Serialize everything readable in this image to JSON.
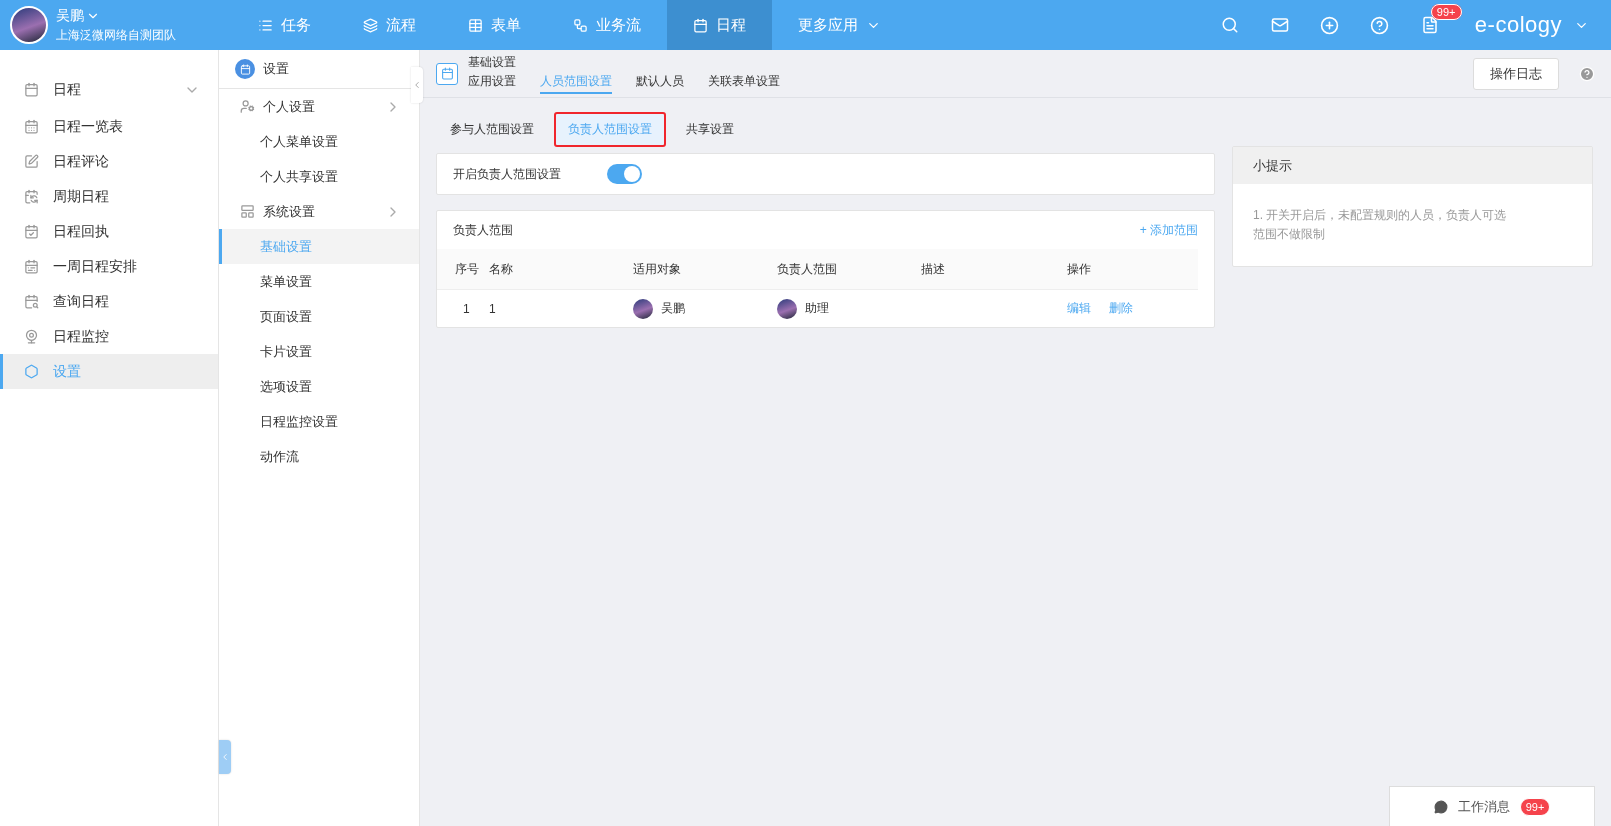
{
  "header": {
    "user": {
      "name": "吴鹏",
      "org": "上海泛微网络自测团队"
    },
    "nav": [
      {
        "label": "任务",
        "selected": false
      },
      {
        "label": "流程",
        "selected": false
      },
      {
        "label": "表单",
        "selected": false
      },
      {
        "label": "业务流",
        "selected": false
      },
      {
        "label": "日程",
        "selected": true
      },
      {
        "label": "更多应用",
        "selected": false
      }
    ],
    "badge": "99+",
    "brand": "e-cology"
  },
  "sidebar": {
    "title": {
      "label": "日程",
      "expanded": true
    },
    "items": [
      {
        "label": "日程一览表",
        "selected": false
      },
      {
        "label": "日程评论",
        "selected": false
      },
      {
        "label": "周期日程",
        "selected": false
      },
      {
        "label": "日程回执",
        "selected": false
      },
      {
        "label": "一周日程安排",
        "selected": false
      },
      {
        "label": "查询日程",
        "selected": false
      },
      {
        "label": "日程监控",
        "selected": false
      },
      {
        "label": "设置",
        "selected": true
      }
    ]
  },
  "submenu": {
    "title": "设置",
    "groups": [
      {
        "label": "个人设置",
        "children": [
          {
            "label": "个人菜单设置",
            "selected": false
          },
          {
            "label": "个人共享设置",
            "selected": false
          }
        ]
      },
      {
        "label": "系统设置",
        "children": [
          {
            "label": "基础设置",
            "selected": true
          },
          {
            "label": "菜单设置",
            "selected": false
          },
          {
            "label": "页面设置",
            "selected": false
          },
          {
            "label": "卡片设置",
            "selected": false
          },
          {
            "label": "选项设置",
            "selected": false
          },
          {
            "label": "日程监控设置",
            "selected": false
          },
          {
            "label": "动作流",
            "selected": false
          }
        ]
      }
    ]
  },
  "page": {
    "title": "基础设置",
    "tabs": [
      {
        "label": "应用设置",
        "selected": false
      },
      {
        "label": "人员范围设置",
        "selected": true
      },
      {
        "label": "默认人员",
        "selected": false
      },
      {
        "label": "关联表单设置",
        "selected": false
      }
    ],
    "log_button": "操作日志"
  },
  "subtabs": [
    {
      "label": "参与人范围设置",
      "selected": false
    },
    {
      "label": "负责人范围设置",
      "selected": true
    },
    {
      "label": "共享设置",
      "selected": false
    }
  ],
  "toggle": {
    "label": "开启负责人范围设置",
    "on": true
  },
  "table": {
    "title": "负责人范围",
    "add_link": "+ 添加范围",
    "columns": [
      "序号",
      "名称",
      "适用对象",
      "负责人范围",
      "描述",
      "操作"
    ],
    "rows": [
      {
        "index": "1",
        "name": "1",
        "target": "吴鹏",
        "scope": "助理",
        "actions": [
          "编辑",
          "删除"
        ]
      }
    ]
  },
  "tips": {
    "title": "小提示",
    "text": "1. 开关开启后，未配置规则的人员，负责人可选范围不做限制"
  },
  "message_button": {
    "label": "工作消息",
    "badge": "99+"
  }
}
